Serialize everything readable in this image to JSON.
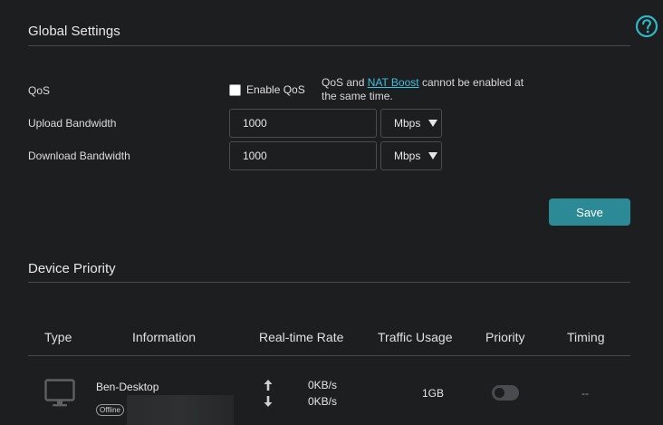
{
  "global_settings": {
    "title": "Global Settings",
    "qos": {
      "label": "QoS",
      "checkbox_label": "Enable QoS",
      "checked": false,
      "note_prefix": "QoS and ",
      "note_link": "NAT Boost",
      "note_suffix": " cannot be enabled at the same time."
    },
    "upload": {
      "label": "Upload Bandwidth",
      "value": "1000",
      "unit": "Mbps"
    },
    "download": {
      "label": "Download Bandwidth",
      "value": "1000",
      "unit": "Mbps"
    },
    "save_label": "Save",
    "accent_color": "#2b8a95",
    "link_color": "#3fc1e0"
  },
  "help": {
    "icon": "question-circle-icon"
  },
  "device_priority": {
    "title": "Device Priority",
    "columns": [
      "Type",
      "Information",
      "Real-time Rate",
      "Traffic Usage",
      "Priority",
      "Timing"
    ],
    "rows": [
      {
        "type_icon": "desktop-icon",
        "name": "Ben-Desktop",
        "status": "Offline",
        "upload_rate": "0KB/s",
        "download_rate": "0KB/s",
        "traffic_usage": "1GB",
        "priority_on": false,
        "timing": "--"
      }
    ]
  }
}
